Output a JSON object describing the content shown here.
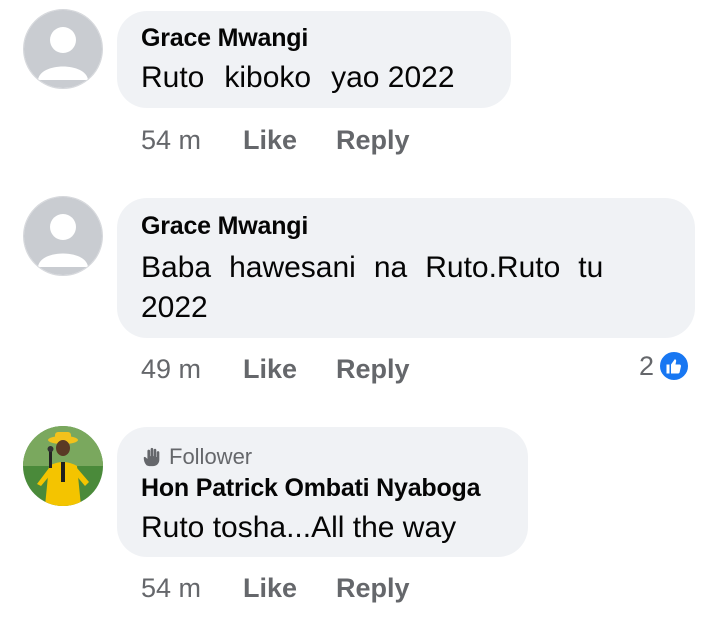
{
  "comments": [
    {
      "author": "Grace Mwangi",
      "text_parts": [
        "Ruto",
        "kiboko",
        "yao 2022"
      ],
      "time": "54 m",
      "like_label": "Like",
      "reply_label": "Reply"
    },
    {
      "author": "Grace Mwangi",
      "text_line1_parts": [
        "Baba",
        "hawesani",
        "na",
        "Ruto.Ruto",
        "tu"
      ],
      "text_line2": "2022",
      "time": "49 m",
      "like_label": "Like",
      "reply_label": "Reply",
      "reaction_count": "2",
      "reaction_icon": "thumbs-up-icon"
    },
    {
      "badge": "Follower",
      "badge_icon": "waving-hand-icon",
      "author": "Hon Patrick Ombati Nyaboga",
      "text": "Ruto tosha...All the way",
      "time": "54 m",
      "like_label": "Like",
      "reply_label": "Reply"
    }
  ],
  "colors": {
    "bubble": "#f0f2f5",
    "secondary_text": "#65676b",
    "like_blue": "#1877f2"
  }
}
